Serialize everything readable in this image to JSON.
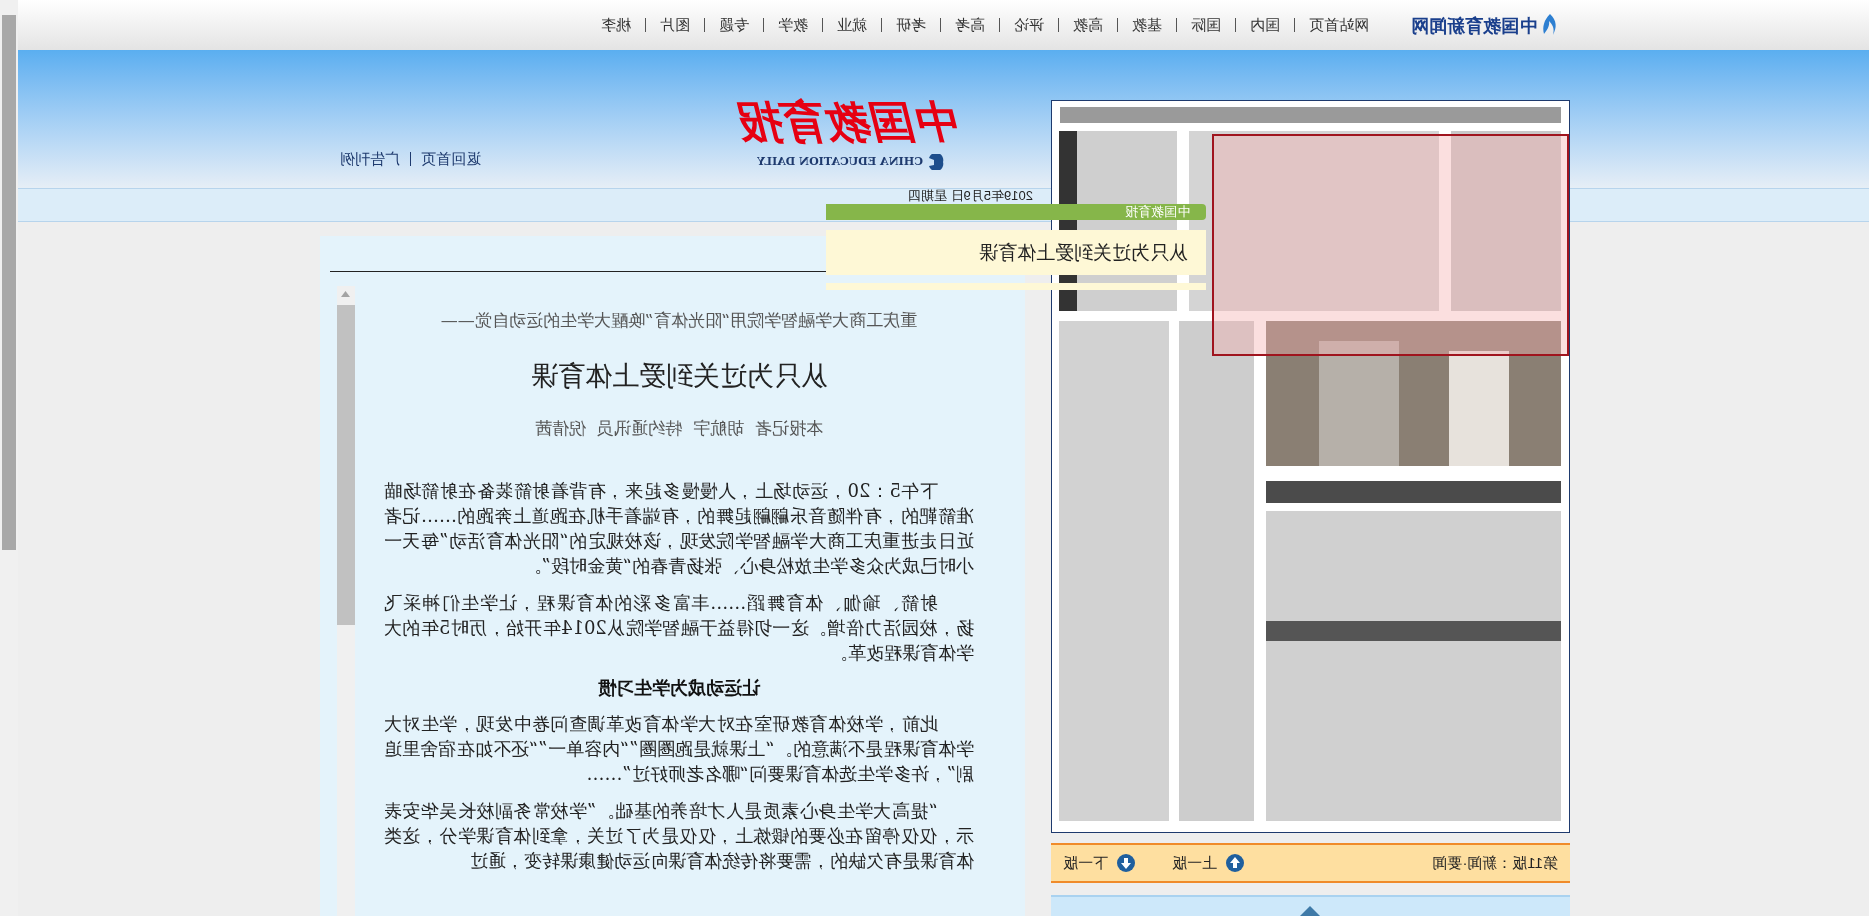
{
  "site_logo": {
    "text": "中国教育新闻网"
  },
  "nav": [
    {
      "label": "桃李"
    },
    {
      "label": "图片"
    },
    {
      "label": "专题"
    },
    {
      "label": "教学"
    },
    {
      "label": "就业"
    },
    {
      "label": "考研"
    },
    {
      "label": "高考"
    },
    {
      "label": "评论"
    },
    {
      "label": "高教"
    },
    {
      "label": "基教"
    },
    {
      "label": "国际"
    },
    {
      "label": "国内"
    },
    {
      "label": "网站首页"
    }
  ],
  "masthead": {
    "title": "中国教育报",
    "subtitle": "CHINA EDUCATION DAILY"
  },
  "header_links": [
    "广告刊例",
    "返回首页"
  ],
  "date": "2019年5月9日 星期四",
  "overlay": {
    "label": "中国教育报",
    "headline": "从只为过关到爱上体育课"
  },
  "article": {
    "kicker": "重庆工商大学融智学院用“阳光体育”唤醒大学生的运动自觉——",
    "title": "从只为过关到爱上体育课",
    "byline": "本报记者  胡航宇  特约通讯员  倪倩茜",
    "blocks": [
      {
        "kind": "paragraph",
        "text": "下午5：20，运动场上，人慢慢多起来，有背着射箭装备在射箭场瞄准箭靶的，有伴随音乐翩翩起舞的，有端着手机在跑道上奔跑的……记者近日走进重庆工商大学融智学院发现，该校规定的“阳光体育活动”每天一小时已成为众多学生放松身心、张扬青春的“黄金时段”。"
      },
      {
        "kind": "paragraph",
        "text": "射箭、瑜伽、体育舞蹈……丰富多彩的体育课程，让学生们神采飞扬，校园活力倍增。这一切得益于融智学院从2014年开始，历时5年的大学体育课程改革。"
      },
      {
        "kind": "heading",
        "text": "让运动成为学生习惯"
      },
      {
        "kind": "paragraph",
        "text": "此前，学校体育教研室在对大学体育改革调查问卷中发现，学生对大学体育课程是不满意的。“上课就是跑圈圈”“内容单一”“还不如在宿舍里追剧”，许多学生选体育课要问“哪名老师好过”……"
      },
      {
        "kind": "paragraph",
        "text": "“提高大学生身心素质是人才培养的基础。”学校常务副校长吴华安表示，仅仅停留在必要的锻炼上，仅仅是为了过关，拿到体育课学分，这类体育课是有欠缺的，需要将传统体育课向运动健康课转变，通过"
      }
    ]
  },
  "pager": {
    "page_label": "第11版：新闻·要闻",
    "prev": "上一版",
    "next": "下一版"
  }
}
